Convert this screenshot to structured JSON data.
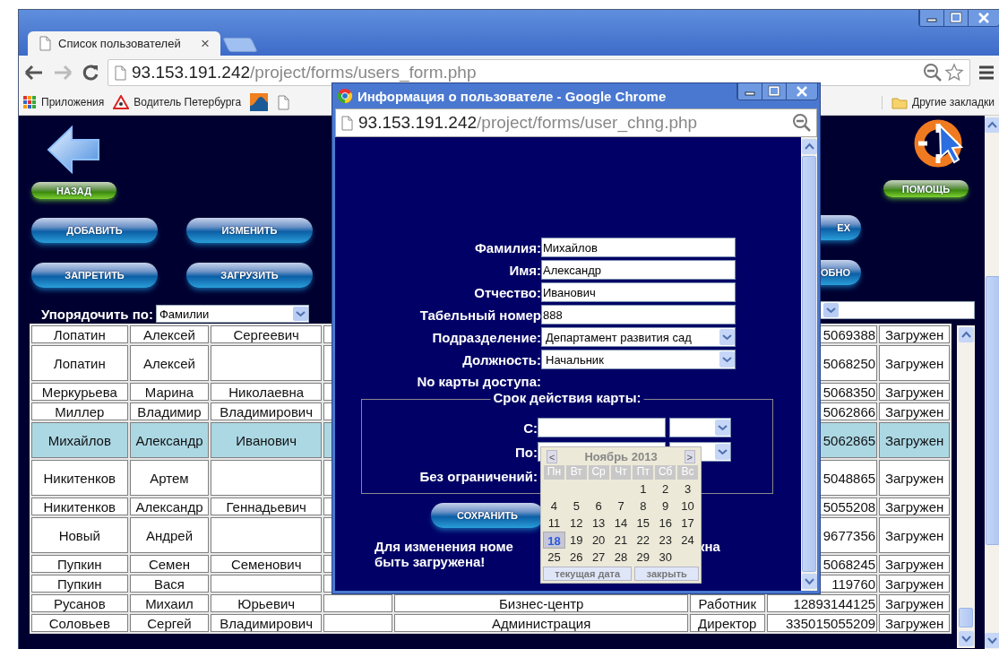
{
  "browser": {
    "tab_title": "Список пользователей",
    "tab_close": "×",
    "url_host": "93.153.191.242",
    "url_path": "/project/forms/users_form.php",
    "bookmarks": [
      {
        "kind": "apps",
        "label": "Приложения"
      },
      {
        "kind": "sign",
        "label": "Водитель Петербурга"
      },
      {
        "kind": "chart"
      },
      {
        "kind": "page"
      }
    ],
    "other_bookmarks": "Другие закладки"
  },
  "page": {
    "back_button": "НАЗАД",
    "help_button": "ПОМОЩЬ",
    "left_buttons": [
      "ДОБАВИТЬ",
      "ИЗМЕНИТЬ",
      "ЗАПРЕТИТЬ",
      "ЗАГРУЗИТЬ"
    ],
    "right_buttons": [
      "ЕХ",
      "ОБНО"
    ],
    "sort": {
      "label": "Упорядочить по:",
      "value": "Фамилии"
    },
    "table": {
      "rows": [
        {
          "last": "Лопатин",
          "first": "Алексей",
          "middle": "Сергеевич",
          "card": "5069388",
          "status": "Загружен",
          "selected": false
        },
        {
          "last": "Лопатин",
          "first": "Алексей",
          "card": "5068250",
          "status": "Загружен",
          "selected": false
        },
        {
          "last": "Меркурьева",
          "first": "Марина",
          "middle": "Николаевна",
          "card": "5068350",
          "status": "Загружен",
          "selected": false
        },
        {
          "last": "Миллер",
          "first": "Владимир",
          "middle": "Владимирович",
          "card": "5062866",
          "status": "Загружен",
          "selected": false
        },
        {
          "last": "Михайлов",
          "first": "Александр",
          "middle": "Иванович",
          "card": "5062865",
          "status": "Загружен",
          "selected": true
        },
        {
          "last": "Никитенков",
          "first": "Артем",
          "card": "5048865",
          "status": "Загружен",
          "selected": false
        },
        {
          "last": "Никитенков",
          "first": "Александр",
          "middle": "Геннадьевич",
          "card": "5055208",
          "status": "Загружен",
          "selected": false
        },
        {
          "last": "Новый",
          "first": "Андрей",
          "card": "9677356",
          "status": "Загружен",
          "selected": false
        },
        {
          "last": "Пупкин",
          "first": "Семен",
          "middle": "Семенович",
          "card": "5068245",
          "status": "Загружен",
          "selected": false
        },
        {
          "last": "Пупкин",
          "first": "Вася",
          "card": "119760",
          "status": "Загружен",
          "selected": false
        },
        {
          "last": "Русанов",
          "first": "Михаил",
          "middle": "Юрьевич",
          "department": "Бизнес-центр",
          "position": "Работник",
          "card": "12893144125",
          "status": "Загружен",
          "selected": false
        },
        {
          "last": "Соловьев",
          "first": "Сергей",
          "middle": "Владимирович",
          "department": "Администрация",
          "position": "Директор",
          "card": "335015055209",
          "status": "Загружен",
          "selected": false
        }
      ]
    }
  },
  "popup": {
    "title": "Информация о пользователе - Google Chrome",
    "url_host": "93.153.191.242",
    "url_path": "/project/forms/user_chng.php",
    "fields": [
      {
        "label": "Фамилия:",
        "kind": "text",
        "value": "Михайлов"
      },
      {
        "label": "Имя:",
        "kind": "text",
        "value": "Александр"
      },
      {
        "label": "Отчество:",
        "kind": "text",
        "value": "Иванович"
      },
      {
        "label": "Табельный номер",
        "kind": "text",
        "value": "888"
      },
      {
        "label": "Подразделение:",
        "kind": "select",
        "value": "Департамент развития сад"
      },
      {
        "label": "Должность:",
        "kind": "select",
        "value": "Начальник"
      },
      {
        "label": "No карты доступа:",
        "kind": "none"
      }
    ],
    "validity": {
      "legend": "Срок действия карты:",
      "rows": [
        {
          "label": "С:",
          "kind": "date"
        },
        {
          "label": "По:",
          "kind": "date"
        },
        {
          "label": "Без ограничений:",
          "kind": "none"
        }
      ]
    },
    "save_button": "СОХРАНИТЬ",
    "message": {
      "line1_start": "Для изменения номе",
      "line1_end": "кна",
      "line2": "быть загружена!"
    },
    "calendar": {
      "prev": "<",
      "month": "Ноябрь 2013",
      "next": ">",
      "weekdays": [
        "Пн",
        "Вт",
        "Ср",
        "Чт",
        "Пт",
        "Сб",
        "Вс"
      ],
      "weeks": [
        [
          {
            "kind": "blank"
          },
          {
            "kind": "blank"
          },
          {
            "kind": "blank"
          },
          {
            "kind": "blank"
          },
          {
            "day": "1",
            "selected": false
          },
          {
            "day": "2",
            "selected": false
          },
          {
            "day": "3",
            "selected": false
          }
        ],
        [
          {
            "day": "4",
            "selected": false
          },
          {
            "day": "5",
            "selected": false
          },
          {
            "day": "6",
            "selected": false
          },
          {
            "day": "7",
            "selected": false
          },
          {
            "day": "8",
            "selected": false
          },
          {
            "day": "9",
            "selected": false
          },
          {
            "day": "10",
            "selected": false
          }
        ],
        [
          {
            "day": "11",
            "selected": false
          },
          {
            "day": "12",
            "selected": false
          },
          {
            "day": "13",
            "selected": false
          },
          {
            "day": "14",
            "selected": false
          },
          {
            "day": "15",
            "selected": false
          },
          {
            "day": "16",
            "selected": false
          },
          {
            "day": "17",
            "selected": false
          }
        ],
        [
          {
            "day": "18",
            "selected": true
          },
          {
            "day": "19",
            "selected": false
          },
          {
            "day": "20",
            "selected": false
          },
          {
            "day": "21",
            "selected": false
          },
          {
            "day": "22",
            "selected": false
          },
          {
            "day": "23",
            "selected": false
          },
          {
            "day": "24",
            "selected": false
          }
        ],
        [
          {
            "day": "25",
            "selected": false
          },
          {
            "day": "26",
            "selected": false
          },
          {
            "day": "27",
            "selected": false
          },
          {
            "day": "28",
            "selected": false
          },
          {
            "day": "29",
            "selected": false
          },
          {
            "day": "30",
            "selected": false
          },
          {
            "kind": "blank"
          }
        ]
      ],
      "today_button": "текущая дата",
      "close_button": "закрыть"
    }
  }
}
